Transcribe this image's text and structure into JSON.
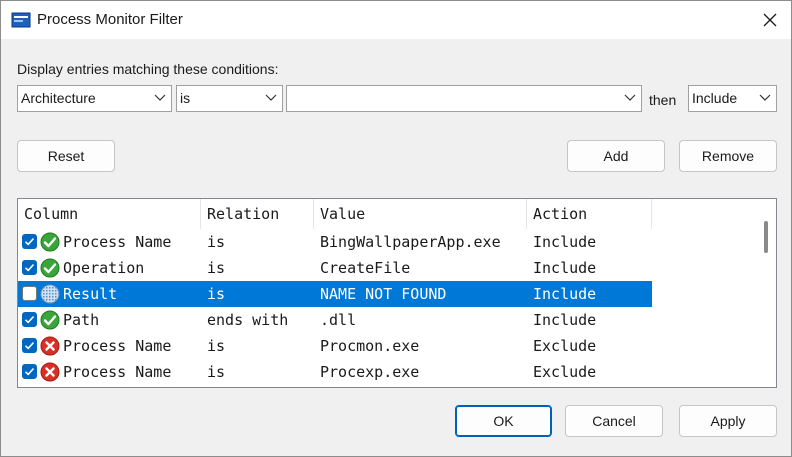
{
  "window": {
    "title": "Process Monitor Filter"
  },
  "prompt": "Display entries matching these conditions:",
  "condition": {
    "column_value": "Architecture",
    "relation_value": "is",
    "value_text": "",
    "then_label": "then",
    "action_value": "Include"
  },
  "buttons": {
    "reset": "Reset",
    "add": "Add",
    "remove": "Remove",
    "ok": "OK",
    "cancel": "Cancel",
    "apply": "Apply"
  },
  "list": {
    "headers": {
      "column": "Column",
      "relation": "Relation",
      "value": "Value",
      "action": "Action"
    },
    "rows": [
      {
        "checked": true,
        "icon": "include-check-icon",
        "column": "Process Name",
        "relation": "is",
        "value": "BingWallpaperApp.exe",
        "action": "Include"
      },
      {
        "checked": true,
        "icon": "include-check-icon",
        "column": "Operation",
        "relation": "is",
        "value": "CreateFile",
        "action": "Include"
      },
      {
        "checked": false,
        "icon": "disabled-filter-icon",
        "column": "Result",
        "relation": "is",
        "value": "NAME NOT FOUND",
        "action": "Include",
        "selected": true
      },
      {
        "checked": true,
        "icon": "include-check-icon",
        "column": "Path",
        "relation": "ends with",
        "value": ".dll",
        "action": "Include"
      },
      {
        "checked": true,
        "icon": "exclude-x-icon",
        "column": "Process Name",
        "relation": "is",
        "value": "Procmon.exe",
        "action": "Exclude"
      },
      {
        "checked": true,
        "icon": "exclude-x-icon",
        "column": "Process Name",
        "relation": "is",
        "value": "Procexp.exe",
        "action": "Exclude"
      }
    ]
  },
  "colors": {
    "selection": "#0078d7",
    "checkbox_on": "#0067c0",
    "include_green": "#3aa53a",
    "exclude_red": "#d93025",
    "default_button_border": "#005fb8"
  }
}
